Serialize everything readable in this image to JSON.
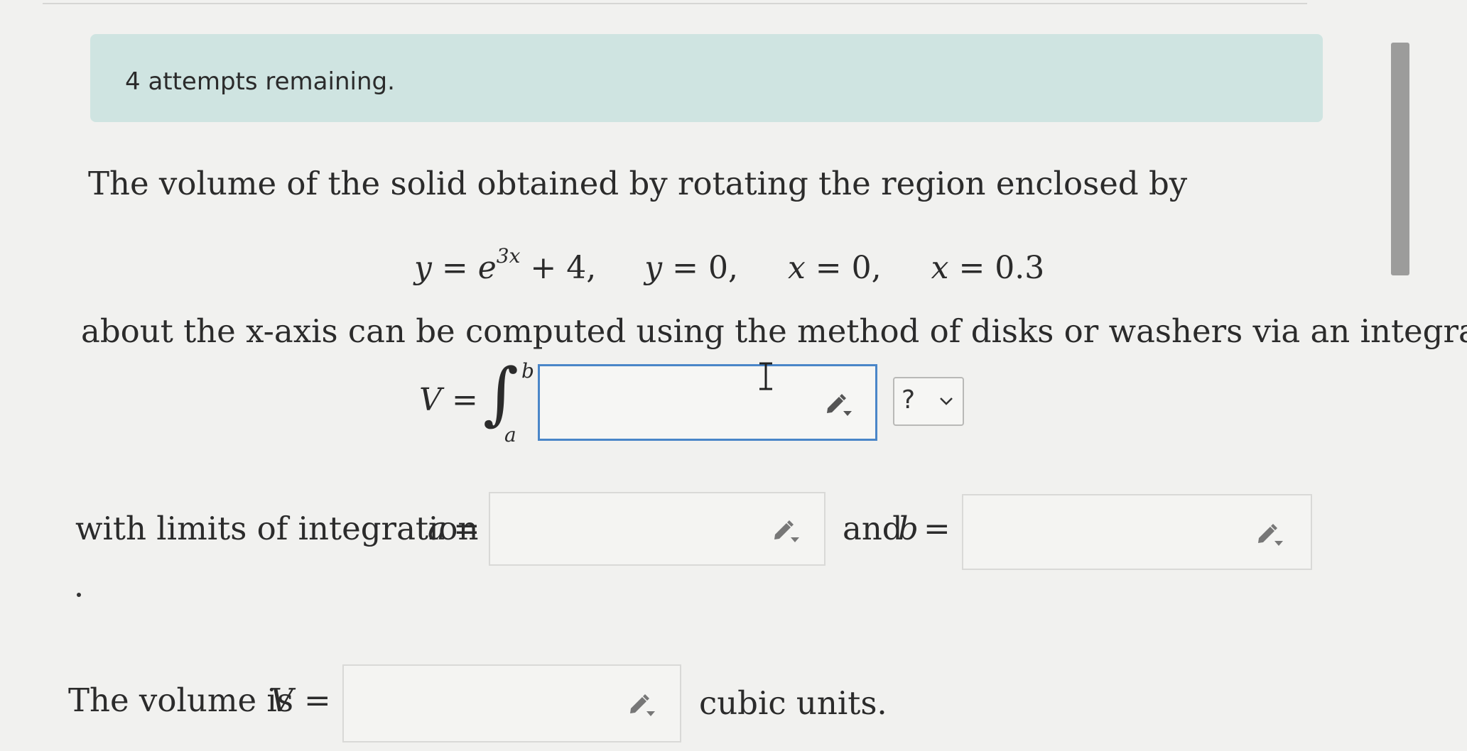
{
  "banner": {
    "attempts_text": "4 attempts remaining."
  },
  "question": {
    "line1": "The volume of the solid obtained by rotating the region enclosed by",
    "equations": {
      "eq1_lhs": "y",
      "eq1_eq": "=",
      "eq1_base": "e",
      "eq1_exp": "3x",
      "eq1_rest": "+ 4,",
      "eq2_lhs": "y",
      "eq2_rest": "= 0,",
      "eq3_lhs": "x",
      "eq3_rest": "= 0,",
      "eq4_lhs": "x",
      "eq4_rest": "= 0.3"
    },
    "line2": "about the x-axis can be computed using the method of disks or washers via an integral",
    "integral": {
      "lhs_var": "V",
      "lhs_eq": "=",
      "sign": "∫",
      "upper": "b",
      "lower": "a",
      "integrand_value": "",
      "units_dropdown_value": "?"
    },
    "limits": {
      "prefix": "with limits of integration",
      "a_var": "a",
      "a_eq": "=",
      "a_value": "",
      "and_text": "and",
      "b_var": "b",
      "b_eq": "=",
      "b_value": ""
    },
    "trailing_period": ".",
    "volume": {
      "prefix": "The volume is",
      "var": "V",
      "eq": "=",
      "value": "",
      "suffix": "cubic units."
    }
  },
  "icons": {
    "math_editor": "pencil-dropdown-icon",
    "dropdown_chevron": "chevron-down-icon",
    "text_cursor": "ibeam-cursor-icon"
  },
  "colors": {
    "banner_bg": "#cfe4e1",
    "focus_border": "#4a86c8",
    "page_bg": "#f1f1ef",
    "scrollbar": "#9c9c9b"
  }
}
